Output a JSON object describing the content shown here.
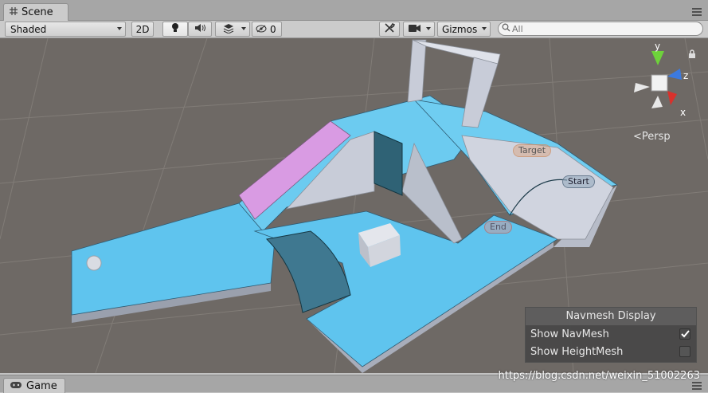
{
  "scene_tab": {
    "label": "Scene",
    "icon": "hash-icon"
  },
  "toolbar": {
    "shading_mode": "Shaded",
    "twod_label": "2D",
    "lighting_icon": "lightbulb-icon",
    "audio_icon": "speaker-icon",
    "effects_icon": "layers-icon",
    "hidden_count": "0",
    "tools_icon": "wrench-icon",
    "camera_icon": "camera-icon",
    "gizmos_label": "Gizmos",
    "search_placeholder": "All"
  },
  "viewport": {
    "projection_label": "Persp",
    "axis_labels": {
      "y": "y",
      "z": "z",
      "x": "x"
    },
    "markers": {
      "target": "Target",
      "start": "Start",
      "end": "End"
    },
    "colors": {
      "background": "#6e6965",
      "navmesh": "#5fc4ee",
      "platform": "#c8ccd8",
      "ramp_top": "#d99be3"
    }
  },
  "navmesh_display": {
    "title": "Navmesh Display",
    "show_navmesh_label": "Show NavMesh",
    "show_navmesh_checked": true,
    "show_heightmesh_label": "Show HeightMesh",
    "show_heightmesh_checked": false
  },
  "game_tab": {
    "label": "Game"
  },
  "watermark": "https://blog.csdn.net/weixin_51002263"
}
